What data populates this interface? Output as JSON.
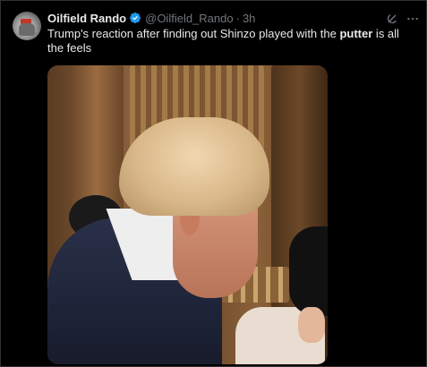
{
  "tweet": {
    "author_name": "Oilfield Rando",
    "handle": "@Oilfield_Rando",
    "separator": "·",
    "time": "3h",
    "text_before": "Trump's reaction after finding out Shinzo played with the ",
    "text_bold": "putter",
    "text_after": " is all the feels",
    "verified_color": "#1d9bf0"
  },
  "icons": {
    "verified": "verified-badge-icon",
    "grok": "grok-icon",
    "more": "more-options-icon"
  },
  "colors": {
    "background": "#000000",
    "text": "#e7e9ea",
    "muted": "#71767b",
    "accent": "#1d9bf0"
  }
}
